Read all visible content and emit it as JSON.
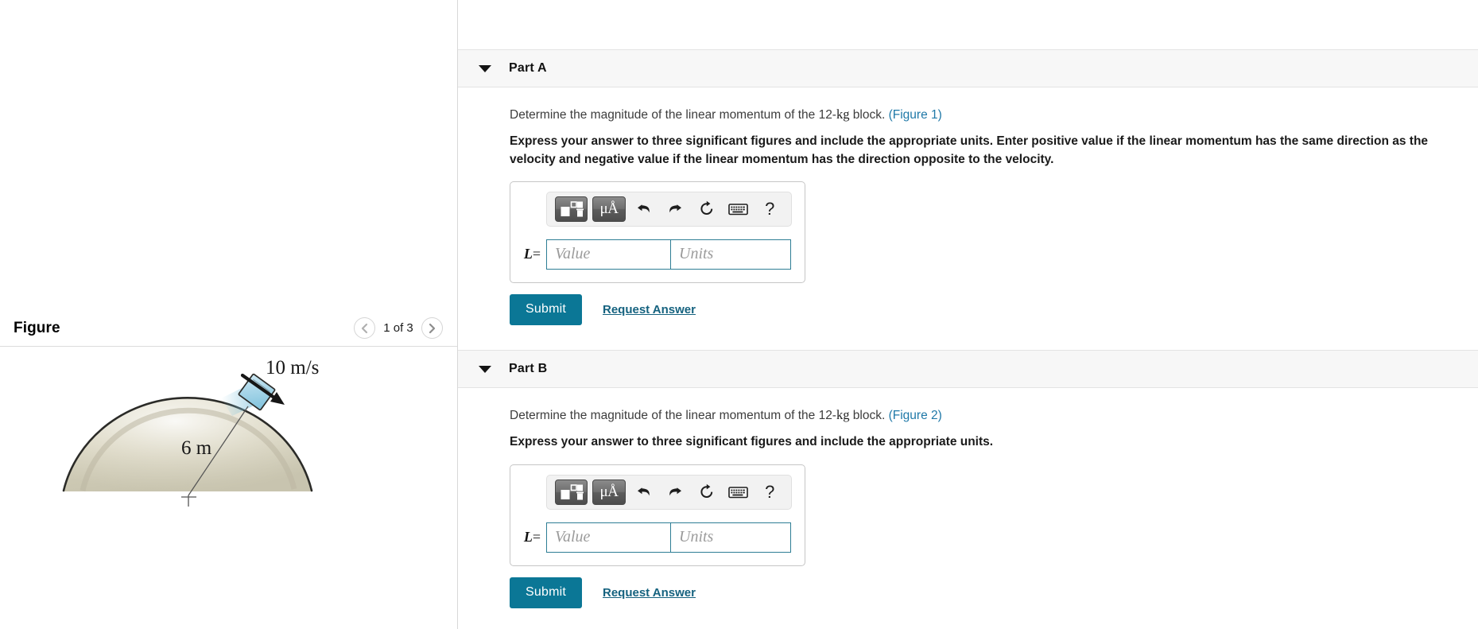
{
  "figure_panel": {
    "title": "Figure",
    "nav": {
      "prev_icon": "chevron-left-icon",
      "next_icon": "chevron-right-icon",
      "counter": "1 of 3"
    },
    "illustration": {
      "velocity_label": "10 m/s",
      "radius_label": "6 m",
      "block_fill": "#a9d7e8",
      "dome_fill": "#d9d5c2",
      "dome_stroke": "#2b2b28"
    }
  },
  "parts": [
    {
      "id": "part-a",
      "label": "Part A",
      "caret_icon": "caret-down-icon",
      "question_prefix": "Determine the magnitude of the linear momentum of the 12-",
      "question_unit": "kg",
      "question_suffix": " block. ",
      "figure_link": "(Figure 1)",
      "instruction": "Express your answer to three significant figures and include the appropriate units. Enter positive value if the linear momentum has the same direction as the velocity and negative value if the linear momentum has the direction opposite to the velocity.",
      "toolbar": {
        "template_icon": "math-template-icon",
        "units_label": "μÅ",
        "undo_icon": "undo-icon",
        "redo_icon": "redo-icon",
        "reset_icon": "reset-icon",
        "keyboard_icon": "keyboard-icon",
        "help_label": "?"
      },
      "answer": {
        "symbol": "L",
        "equals": "=",
        "value": "",
        "value_placeholder": "Value",
        "units": "",
        "units_placeholder": "Units"
      },
      "submit_label": "Submit",
      "request_label": "Request Answer"
    },
    {
      "id": "part-b",
      "label": "Part B",
      "caret_icon": "caret-down-icon",
      "question_prefix": "Determine the magnitude of the linear momentum of the 12-",
      "question_unit": "kg",
      "question_suffix": " block. ",
      "figure_link": "(Figure 2)",
      "instruction": "Express your answer to three significant figures and include the appropriate units.",
      "toolbar": {
        "template_icon": "math-template-icon",
        "units_label": "μÅ",
        "undo_icon": "undo-icon",
        "redo_icon": "redo-icon",
        "reset_icon": "reset-icon",
        "keyboard_icon": "keyboard-icon",
        "help_label": "?"
      },
      "answer": {
        "symbol": "L",
        "equals": "=",
        "value": "",
        "value_placeholder": "Value",
        "units": "",
        "units_placeholder": "Units"
      },
      "submit_label": "Submit",
      "request_label": "Request Answer"
    }
  ],
  "colors": {
    "accent": "#0b7796",
    "link": "#2079a8",
    "header_bg": "#f7f7f7",
    "input_border": "#2e7e95"
  }
}
